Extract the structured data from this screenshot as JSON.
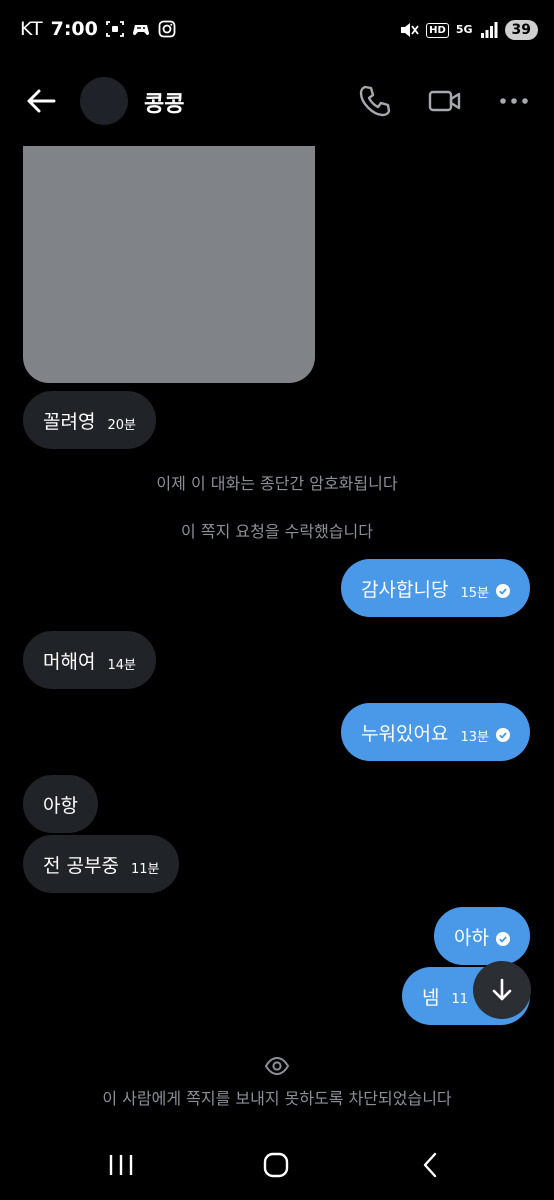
{
  "status_bar": {
    "carrier": "KT",
    "time": "7:00",
    "network": "5G",
    "hd_label": "HD",
    "battery": "39"
  },
  "header": {
    "contact_name": "콩콩"
  },
  "messages": [
    {
      "side": "in",
      "text": "꼴려영",
      "time": "20분"
    },
    {
      "side": "out",
      "text": "감사합니당",
      "time": "15분",
      "read": true
    },
    {
      "side": "in",
      "text": "머해여",
      "time": "14분"
    },
    {
      "side": "out",
      "text": "누워있어요",
      "time": "13분",
      "read": true
    },
    {
      "side": "in",
      "text": "아항",
      "time": ""
    },
    {
      "side": "in",
      "text": "전 공부중",
      "time": "11분"
    },
    {
      "side": "out",
      "text": "아하",
      "time": "",
      "read": true
    },
    {
      "side": "out",
      "text": "넴",
      "time": "11"
    }
  ],
  "system": {
    "encrypted_notice": "이제 이 대화는 종단간 암호화됩니다",
    "accepted_notice": "이 쪽지 요청을 수락했습니다",
    "blocked_notice": "이 사람에게 쪽지를 보내지 못하도록 차단되었습니다"
  },
  "colors": {
    "outgoing_bubble": "#4a99e9",
    "incoming_bubble": "#202327",
    "background": "#000000",
    "muted_text": "#8b8f96"
  }
}
